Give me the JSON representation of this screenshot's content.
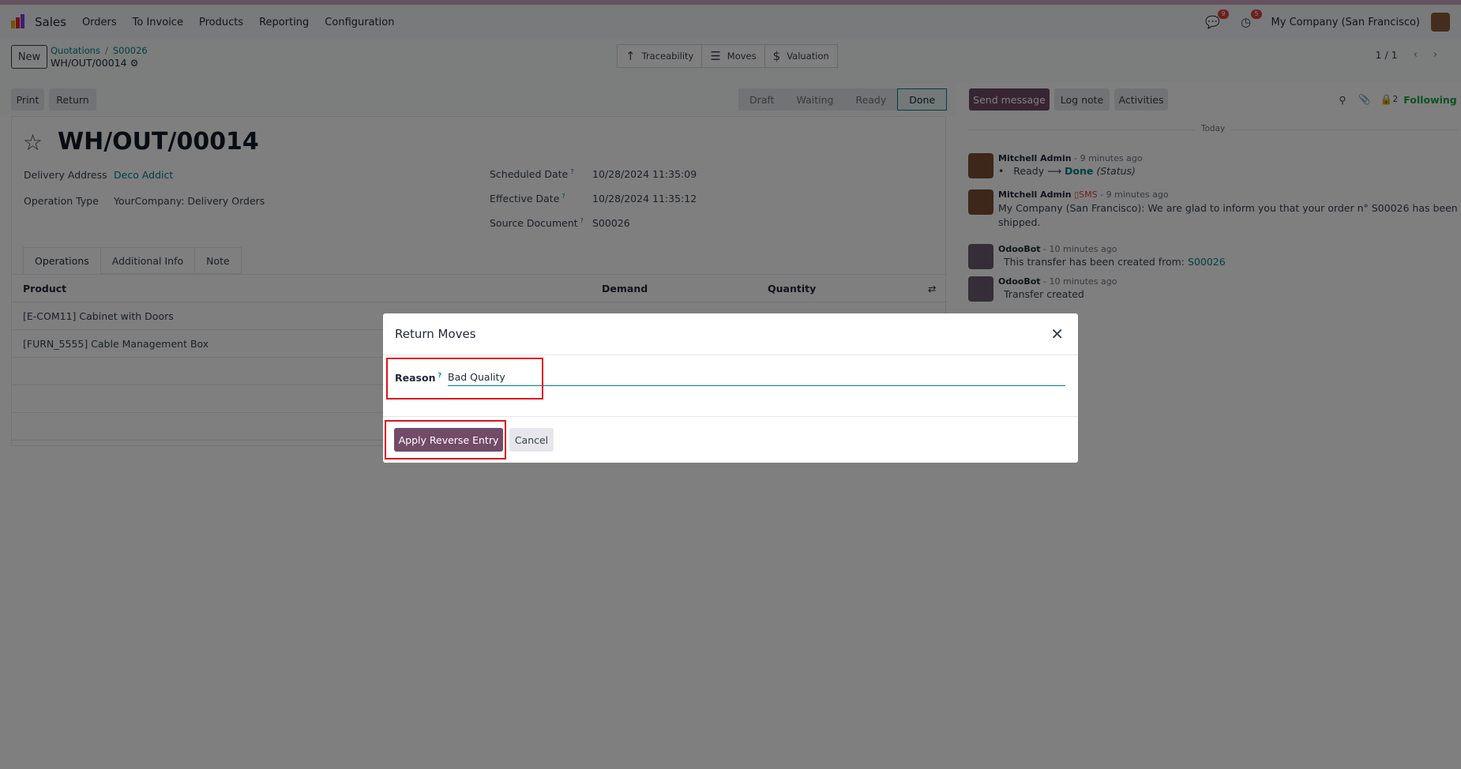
{
  "navbar": {
    "app_name": "Sales",
    "menu": [
      "Orders",
      "To Invoice",
      "Products",
      "Reporting",
      "Configuration"
    ],
    "messages_badge": "9",
    "activities_badge": "5",
    "company": "My Company (San Francisco)"
  },
  "control_panel": {
    "new_label": "New",
    "breadcrumb": [
      "Quotations",
      "S00026"
    ],
    "record_name": "WH/OUT/00014",
    "smart_buttons": [
      "Traceability",
      "Moves",
      "Valuation"
    ],
    "pager": "1 / 1"
  },
  "actions": {
    "print": "Print",
    "return": "Return",
    "stages": [
      "Draft",
      "Waiting",
      "Ready",
      "Done"
    ],
    "active_stage": "Done"
  },
  "form": {
    "title": "WH/OUT/00014",
    "delivery_address_label": "Delivery Address",
    "delivery_address": "Deco Addict",
    "operation_type_label": "Operation Type",
    "operation_type": "YourCompany: Delivery Orders",
    "scheduled_date_label": "Scheduled Date",
    "scheduled_date": "10/28/2024 11:35:09",
    "effective_date_label": "Effective Date",
    "effective_date": "10/28/2024 11:35:12",
    "source_document_label": "Source Document",
    "source_document": "S00026",
    "tabs": [
      "Operations",
      "Additional Info",
      "Note"
    ],
    "table_headers": [
      "Product",
      "Demand",
      "Quantity"
    ],
    "rows": [
      "[E-COM11] Cabinet with Doors",
      "[FURN_5555] Cable Management Box"
    ]
  },
  "chatter": {
    "send_message": "Send message",
    "log_note": "Log note",
    "activities": "Activities",
    "followers_count": "2",
    "following": "Following",
    "today": "Today",
    "messages": [
      {
        "author": "Mitchell Admin",
        "time": "- 9 minutes ago",
        "from": "Ready",
        "to": "Done",
        "field": "(Status)"
      },
      {
        "author": "Mitchell Admin",
        "tag": "SMS",
        "time": "- 9 minutes ago",
        "body_line1": "My Company (San Francisco): We are glad to inform you that your order n° S00026 has been",
        "body_line2": "shipped."
      },
      {
        "author": "OdooBot",
        "time": "- 10 minutes ago",
        "body": "This transfer has been created from:",
        "link": "S00026"
      },
      {
        "author": "OdooBot",
        "time": "- 10 minutes ago",
        "body": "Transfer created"
      }
    ]
  },
  "dialog": {
    "title": "Return Moves",
    "reason_label": "Reason",
    "reason_value": "Bad Quality",
    "apply_label": "Apply Reverse Entry",
    "cancel_label": "Cancel"
  },
  "colors": {
    "brand": "#714b67",
    "link": "#017e84",
    "highlight": "#e0101c",
    "stripe": "#c9a5c0"
  }
}
